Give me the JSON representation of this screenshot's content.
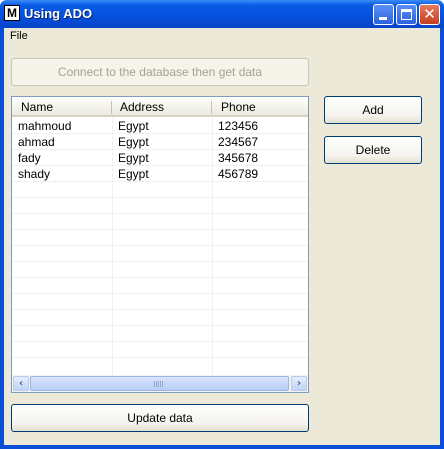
{
  "window": {
    "title": "Using ADO",
    "icon_letter": "M",
    "close_glyph": "✕"
  },
  "menu": {
    "file_label": "File"
  },
  "toolbar": {
    "connect_label": "Connect to the database then get data",
    "add_label": "Add",
    "delete_label": "Delete",
    "update_label": "Update data"
  },
  "grid": {
    "columns": [
      "Name",
      "Address",
      "Phone"
    ],
    "rows": [
      [
        "mahmoud",
        "Egypt",
        "123456"
      ],
      [
        "ahmad",
        "Egypt",
        "234567"
      ],
      [
        "fady",
        "Egypt",
        "345678"
      ],
      [
        "shady",
        "Egypt",
        "456789"
      ]
    ]
  },
  "scrollbar": {
    "left_arrow": "‹",
    "right_arrow": "›"
  }
}
